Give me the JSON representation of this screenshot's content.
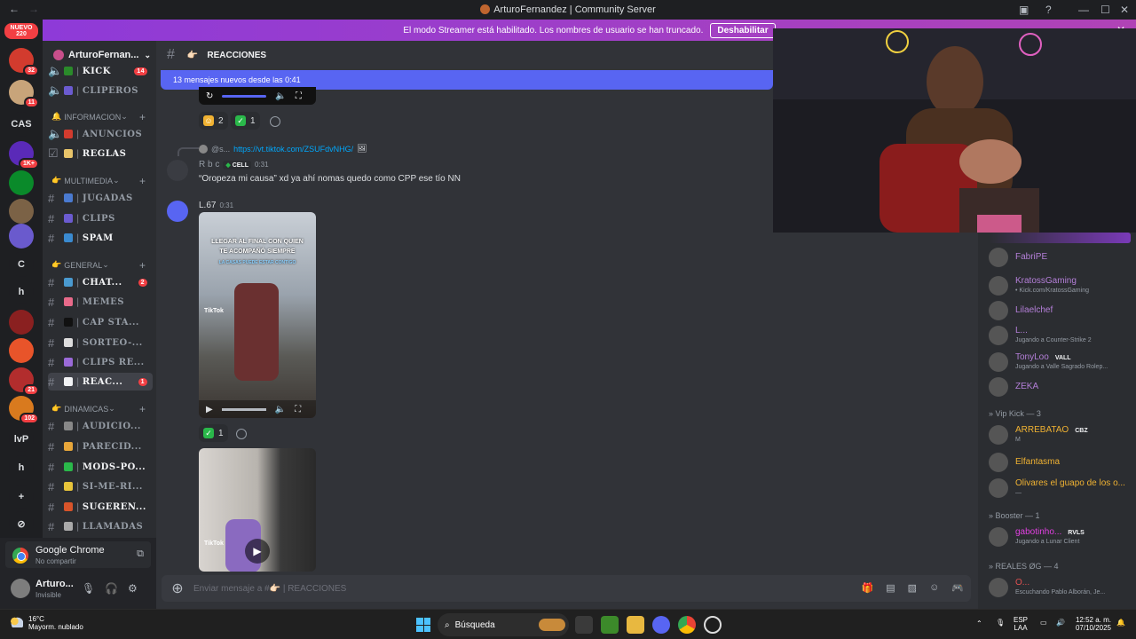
{
  "window": {
    "title": "ArturoFernandez | Community Server",
    "controls": [
      "—",
      "☐",
      "✕"
    ]
  },
  "banner": {
    "text": "El modo Streamer está habilitado. Los nombres de usuario se han truncado.",
    "button": "Deshabilitar"
  },
  "servers": {
    "nuevo_label": "NUEVO",
    "nuevo_count": "220",
    "items": [
      {
        "label": "",
        "badge": "32",
        "color": "#d23b2e"
      },
      {
        "label": "",
        "badge": "11",
        "color": "#c8a47a"
      },
      {
        "label": "CAS",
        "badge": "",
        "color": "#1e1f22"
      },
      {
        "label": "",
        "badge": "1K+",
        "color": "#5a2ab8"
      },
      {
        "label": "",
        "badge": "",
        "color": "#0a8a2a"
      },
      {
        "label": "",
        "badge": "",
        "color": "#7b6246"
      },
      {
        "label": "",
        "badge": "",
        "color": "#6a5acd"
      },
      {
        "label": "C",
        "badge": "",
        "color": "#1e1f22"
      },
      {
        "label": "h",
        "badge": "",
        "color": "#1e1f22"
      },
      {
        "label": "",
        "badge": "",
        "color": "#8a2020"
      },
      {
        "label": "",
        "badge": "",
        "color": "#e8542a"
      },
      {
        "label": "",
        "badge": "21",
        "color": "#b22d2d"
      },
      {
        "label": "",
        "badge": "102",
        "color": "#d97a1e"
      },
      {
        "label": "lvP",
        "badge": "",
        "color": "#1e1f22"
      },
      {
        "label": "h",
        "badge": "",
        "color": "#1e1f22"
      },
      {
        "label": "+",
        "badge": "",
        "color": "#1e1f22"
      },
      {
        "label": "⊘",
        "badge": "",
        "color": "#1e1f22"
      }
    ]
  },
  "guild": {
    "name": "ArturoFernan..."
  },
  "channels": [
    {
      "type": "ch",
      "icon": "speaker",
      "label": "KICK",
      "emoji": "#2a8a2a",
      "count": "14",
      "bright": true
    },
    {
      "type": "ch",
      "icon": "speaker",
      "label": "CLIPEROS",
      "emoji": "#6b5bd0",
      "count": ""
    },
    {
      "type": "cat",
      "label": "INFORMACION",
      "prefix": "🔔"
    },
    {
      "type": "ch",
      "icon": "speaker",
      "label": "ANUNCIOS",
      "emoji": "#d23b2e",
      "count": ""
    },
    {
      "type": "ch",
      "icon": "check",
      "label": "REGLAS",
      "emoji": "#e8c46a",
      "count": "",
      "bright": true
    },
    {
      "type": "cat",
      "label": "MULTIMEDIA",
      "prefix": "👉"
    },
    {
      "type": "ch",
      "icon": "hash",
      "label": "JUGADAS",
      "emoji": "#4a7ad0",
      "count": ""
    },
    {
      "type": "ch",
      "icon": "hash",
      "label": "CLIPS",
      "emoji": "#6b5bd0",
      "count": ""
    },
    {
      "type": "ch",
      "icon": "hash",
      "label": "SPAM",
      "emoji": "#3a8ad0",
      "count": "",
      "bright": true
    },
    {
      "type": "cat",
      "label": "GENERAL",
      "prefix": "👉"
    },
    {
      "type": "ch",
      "icon": "hash",
      "label": "CHAT...",
      "emoji": "#4a9ad0",
      "count": "2",
      "bright": true
    },
    {
      "type": "ch",
      "icon": "hash",
      "label": "MEMES",
      "emoji": "#e86a8a",
      "count": ""
    },
    {
      "type": "ch",
      "icon": "hash",
      "label": "CAP STA...",
      "emoji": "#111111",
      "count": ""
    },
    {
      "type": "ch",
      "icon": "hash",
      "label": "SORTEO-...",
      "emoji": "#dddddd",
      "count": ""
    },
    {
      "type": "ch",
      "icon": "hash",
      "label": "CLIPS RE...",
      "emoji": "#9a6ad8",
      "count": ""
    },
    {
      "type": "ch",
      "icon": "hash",
      "label": "REAC...",
      "emoji": "#f2f3f5",
      "count": "1",
      "active": true
    },
    {
      "type": "cat",
      "label": "DINAMICAS",
      "prefix": "👉"
    },
    {
      "type": "ch",
      "icon": "hash",
      "label": "AUDICIO...",
      "emoji": "#888888",
      "count": ""
    },
    {
      "type": "ch",
      "icon": "hash",
      "label": "PARECID...",
      "emoji": "#e8a63a",
      "count": ""
    },
    {
      "type": "ch",
      "icon": "hash",
      "label": "MODS-PO...",
      "emoji": "#2ab84a",
      "count": "",
      "bright": true
    },
    {
      "type": "ch",
      "icon": "hash",
      "label": "SI-ME-RI...",
      "emoji": "#e8c43a",
      "count": ""
    },
    {
      "type": "ch",
      "icon": "hash",
      "label": "SUGEREN...",
      "emoji": "#d8542a",
      "count": "",
      "bright": true
    },
    {
      "type": "ch",
      "icon": "hash",
      "label": "LLAMADAS",
      "emoji": "#aaaaaa",
      "count": ""
    }
  ],
  "user_panel": {
    "activity_app": "Google Chrome",
    "activity_sub": "No compartir",
    "username": "Arturo...",
    "status": "Invisible"
  },
  "chat": {
    "channel_name": "REACCIONES",
    "new_messages": "13 mensajes nuevos desde las 0:41",
    "reactions_top": [
      {
        "emoji_color": "#f0b232",
        "count": "2"
      },
      {
        "emoji_color": "#2ab84a",
        "count": "1"
      }
    ],
    "reply": {
      "author": "@s...",
      "link": "https://vt.tiktok.com/ZSUFdvNHG/"
    },
    "msg1": {
      "author": "R b c",
      "tag": "CELL",
      "time": "0:31",
      "text": "“Oropeza mi causa” xd ya ahí nomas quedo como CPP ese tío NN"
    },
    "msg2": {
      "author": "L.67",
      "time": "0:31",
      "video_caption_1": "LLEGAR AL FINAL CON QUIEN",
      "video_caption_2": "TE ACOMPAÑÓ SIEMPRE",
      "video_caption_3": "LA CASAS PUEDE ESTAR CONTIGO",
      "tiktok": "TikTok",
      "reaction_count": "1"
    },
    "msg3": {
      "tiktok": "TikTok"
    },
    "composer_placeholder": "Enviar mensaje a #👉🏻 | REACCIONES"
  },
  "members": {
    "groups": [
      {
        "label": "",
        "members": [
          {
            "name": "FabriPE",
            "color": "#b47fd8",
            "activity": ""
          },
          {
            "name": "KratossGaming",
            "color": "#b47fd8",
            "activity": "• Kick.com/KratossGaming"
          },
          {
            "name": "Lilaelchef",
            "color": "#b47fd8",
            "activity": ""
          },
          {
            "name": "L...",
            "color": "#b47fd8",
            "activity": "Jugando a Counter-Strike 2"
          },
          {
            "name": "TonyLoo",
            "color": "#b47fd8",
            "activity": "Jugando a Valle Sagrado Rolep...",
            "tag": "VALL"
          },
          {
            "name": "ZEKA",
            "color": "#b47fd8",
            "activity": ""
          }
        ]
      },
      {
        "label": "» Vip Kick — 3",
        "members": [
          {
            "name": "ARREBATAO",
            "color": "#f0b232",
            "activity": "M",
            "tag": "CBZ"
          },
          {
            "name": "Elfantasma",
            "color": "#f0b232",
            "activity": ""
          },
          {
            "name": "Olivares el guapo de los o...",
            "color": "#f0b232",
            "activity": "—"
          }
        ]
      },
      {
        "label": "» Booster — 1",
        "members": [
          {
            "name": "gabotinho...",
            "color": "#e040e0",
            "activity": "Jugando a Lunar Client",
            "tag": "RVLS"
          }
        ]
      },
      {
        "label": "» REALES ØG — 4",
        "members": [
          {
            "name": "O...",
            "color": "#e05050",
            "activity": "Escuchando Pablo Alborán, Je..."
          }
        ]
      }
    ]
  },
  "taskbar": {
    "temp": "16°C",
    "weather": "Mayorm. nublado",
    "search": "Búsqueda",
    "lang_1": "ESP",
    "lang_2": "LAA",
    "time": "12:52 a. m.",
    "date": "07/10/2025"
  }
}
